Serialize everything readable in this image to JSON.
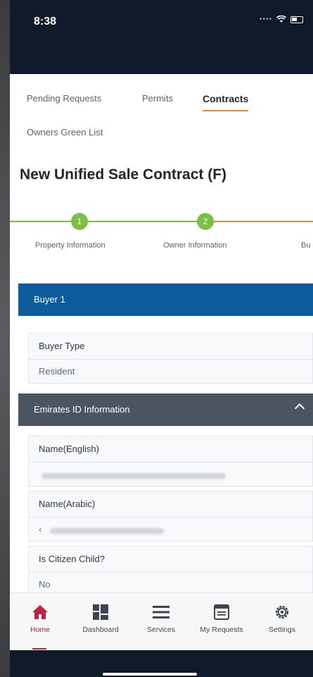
{
  "status": {
    "time": "8:38"
  },
  "tabs": [
    {
      "label": "Pending Requests",
      "active": false
    },
    {
      "label": "Permits",
      "active": false
    },
    {
      "label": "Contracts",
      "active": true
    },
    {
      "label": "Owners Green List",
      "active": false
    }
  ],
  "page_title": "New Unified Sale Contract (F)",
  "stepper": {
    "steps": [
      {
        "number": "1",
        "label": "Property Information",
        "state": "done"
      },
      {
        "number": "2",
        "label": "Owner Information",
        "state": "done"
      },
      {
        "number": "",
        "label": "Bu",
        "state": "current"
      }
    ]
  },
  "buyer_section": {
    "header": "Buyer 1",
    "buyer_type_label": "Buyer Type",
    "buyer_type_value": "Resident"
  },
  "eid_section": {
    "header": "Emirates ID Information",
    "name_en_label": "Name(English)",
    "name_ar_label": "Name(Arabic)",
    "name_ar_prefix": "‹",
    "citizen_child_label": "Is Citizen Child?",
    "citizen_child_value": "No"
  },
  "bottom_nav": [
    {
      "label": "Home",
      "icon": "home-icon",
      "active": true
    },
    {
      "label": "Dashboard",
      "icon": "dashboard-icon",
      "active": false
    },
    {
      "label": "Services",
      "icon": "menu-icon",
      "active": false
    },
    {
      "label": "My Requests",
      "icon": "requests-icon",
      "active": false
    },
    {
      "label": "Settings",
      "icon": "gear-icon",
      "active": false
    }
  ],
  "colors": {
    "primary_blue": "#0d5d9e",
    "accent_orange": "#e8893a",
    "step_green": "#7ac142",
    "nav_active": "#c02146",
    "status_bar": "#0f1a2a"
  }
}
